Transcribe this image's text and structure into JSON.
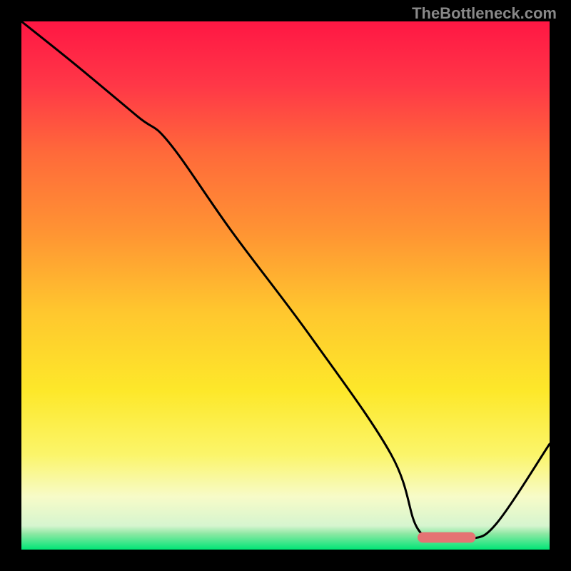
{
  "watermark": "TheBottleneck.com",
  "chart_data": {
    "type": "line",
    "title": "",
    "xlabel": "",
    "ylabel": "",
    "xlim": [
      0,
      100
    ],
    "ylim": [
      0,
      100
    ],
    "gradient_stops": [
      {
        "offset": 0.0,
        "color": "#ff1744"
      },
      {
        "offset": 0.12,
        "color": "#ff3747"
      },
      {
        "offset": 0.25,
        "color": "#ff6a3a"
      },
      {
        "offset": 0.4,
        "color": "#ff9433"
      },
      {
        "offset": 0.55,
        "color": "#ffc72e"
      },
      {
        "offset": 0.7,
        "color": "#fde82a"
      },
      {
        "offset": 0.82,
        "color": "#fbf56a"
      },
      {
        "offset": 0.9,
        "color": "#f7fbc8"
      },
      {
        "offset": 0.955,
        "color": "#d6f5cf"
      },
      {
        "offset": 0.97,
        "color": "#8de8a4"
      },
      {
        "offset": 1.0,
        "color": "#00e676"
      }
    ],
    "series": [
      {
        "name": "bottleneck-curve",
        "color": "#000000",
        "x": [
          0,
          10,
          22,
          28,
          40,
          55,
          70,
          75,
          80,
          85,
          90,
          100
        ],
        "y": [
          100,
          92,
          82,
          77,
          60,
          40,
          18,
          4,
          2,
          2,
          5,
          20
        ]
      }
    ],
    "marker": {
      "name": "optimal-range",
      "x_start": 75,
      "x_end": 86,
      "y": 2.3,
      "color": "#e57373",
      "thickness": 2.0
    }
  }
}
